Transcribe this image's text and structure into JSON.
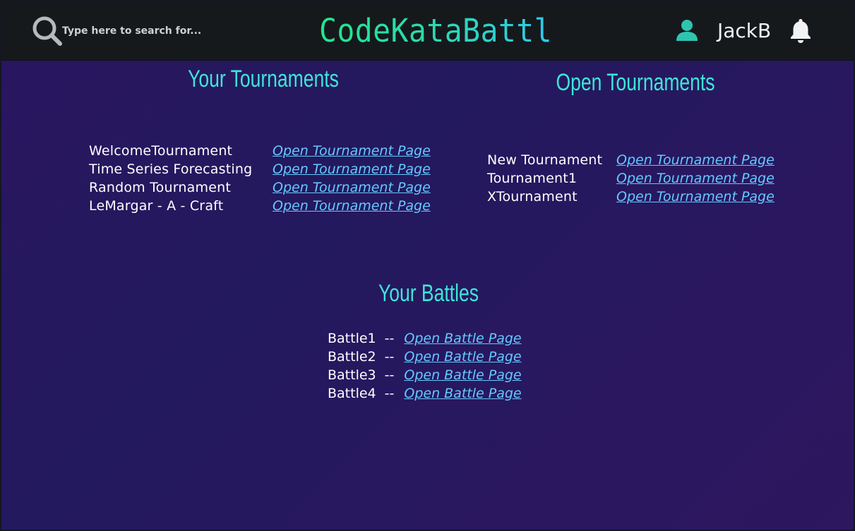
{
  "header": {
    "search": {
      "placeholder": "Type here to search for...",
      "icon": "search-icon"
    },
    "brand": "CodeKataBattle",
    "user": {
      "icon": "user-icon",
      "name": "JackB"
    },
    "notifications": {
      "icon": "bell-icon"
    }
  },
  "your_tournaments": {
    "title": "Your Tournaments",
    "items": [
      {
        "name": "WelcomeTournament",
        "link": "Open Tournament Page"
      },
      {
        "name": "Time Series Forecasting",
        "link": "Open Tournament Page"
      },
      {
        "name": "Random Tournament",
        "link": "Open Tournament Page"
      },
      {
        "name": "LeMargar - A - Craft",
        "link": "Open Tournament Page"
      }
    ]
  },
  "open_tournaments": {
    "title": "Open Tournaments",
    "items": [
      {
        "name": "New Tournament",
        "link": "Open Tournament Page"
      },
      {
        "name": "Tournament1",
        "link": "Open Tournament Page"
      },
      {
        "name": "XTournament",
        "link": "Open Tournament Page"
      }
    ]
  },
  "your_battles": {
    "title": "Your Battles",
    "separator": "--",
    "items": [
      {
        "name": "Battle1",
        "link": "Open Battle Page"
      },
      {
        "name": "Battle2",
        "link": "Open Battle Page"
      },
      {
        "name": "Battle3",
        "link": "Open Battle Page"
      },
      {
        "name": "Battle4",
        "link": "Open Battle Page"
      }
    ]
  },
  "colors": {
    "background": "#261a5f",
    "topbar": "#15191c",
    "heading": "#3ee5d8",
    "link": "#64c9ff",
    "accent": "#2ec4b0"
  }
}
